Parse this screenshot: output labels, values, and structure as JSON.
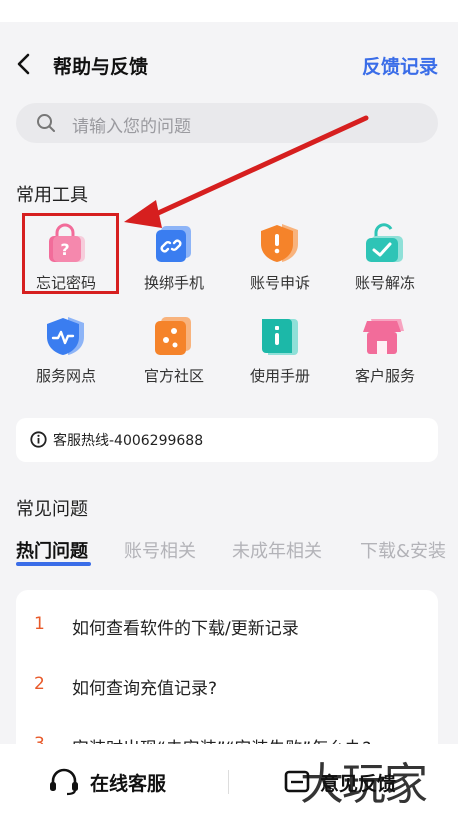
{
  "header": {
    "title": "帮助与反馈",
    "feedback_log": "反馈记录"
  },
  "search": {
    "placeholder": "请输入您的问题"
  },
  "tools": {
    "section_title": "常用工具",
    "items": [
      {
        "label": "忘记密码",
        "icon": "lock-question-icon",
        "color": "#f26c9a"
      },
      {
        "label": "换绑手机",
        "icon": "link-icon",
        "color": "#3a7df0"
      },
      {
        "label": "账号申诉",
        "icon": "shield-alert-icon",
        "color": "#f5832a"
      },
      {
        "label": "账号解冻",
        "icon": "unlock-check-icon",
        "color": "#2ec4b6"
      },
      {
        "label": "服务网点",
        "icon": "service-shield-icon",
        "color": "#3a7df0"
      },
      {
        "label": "官方社区",
        "icon": "community-icon",
        "color": "#f5832a"
      },
      {
        "label": "使用手册",
        "icon": "manual-book-icon",
        "color": "#1cb8a8"
      },
      {
        "label": "客户服务",
        "icon": "store-icon",
        "color": "#f26c9a"
      }
    ]
  },
  "hotline": {
    "text": "客服热线-4006299688"
  },
  "faq": {
    "section_title": "常见问题",
    "tabs": [
      "热门问题",
      "账号相关",
      "未成年相关",
      "下载&安装"
    ],
    "questions": [
      {
        "num": "1",
        "text": "如何查看软件的下载/更新记录"
      },
      {
        "num": "2",
        "text": "如何查询充值记录?"
      },
      {
        "num": "3",
        "text": "安装时出现“未安装”“安装失败”怎么办?"
      }
    ]
  },
  "bottom": {
    "online_service": "在线客服",
    "feedback": "意见反馈"
  },
  "watermark": "大玩家",
  "colors": {
    "accent": "#3a6de8",
    "number": "#e85a2a",
    "annotation": "#d61f1f"
  }
}
